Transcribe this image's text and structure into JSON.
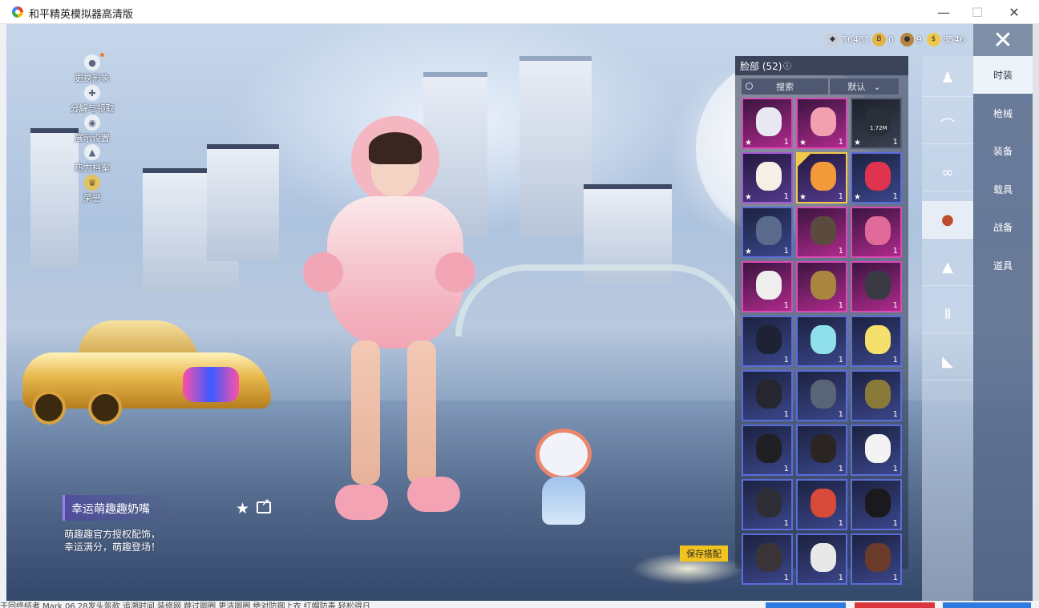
{
  "window": {
    "title": "和平精英模拟器高清版"
  },
  "desktop": {
    "bottom_text": "于回终结者 Mark 06 28发头盔款 追溯时间 装修网 跳过圆圈 更洁圆圈 绝对防御上衣 红帽防毒 轻松得日"
  },
  "left_menu": [
    {
      "label": "更换形象",
      "icon": "avatar-icon",
      "has_dot": true
    },
    {
      "label": "分解与领取",
      "icon": "puzzle-icon"
    },
    {
      "label": "展示设置",
      "icon": "eye-icon"
    },
    {
      "label": "热力档案",
      "icon": "flame-icon"
    },
    {
      "label": "荣誉",
      "icon": "crown-badge-icon"
    }
  ],
  "currency": [
    {
      "icon": "silver-coin-icon",
      "value": "56431",
      "color": "#c8cdd8"
    },
    {
      "icon": "gold-b-coin-icon",
      "value": "0",
      "color": "#e5b341"
    },
    {
      "icon": "bronze-coin-icon",
      "value": "9",
      "color": "#b8833b"
    },
    {
      "icon": "gold-coin-icon",
      "value": "8546",
      "color": "#f0c94b"
    }
  ],
  "panel": {
    "title": "脸部 (52)",
    "search_label": "搜索",
    "sort_label": "默认",
    "items": [
      {
        "name": "clown-mask",
        "rarity": "r-pink",
        "color": "#e8e8f2",
        "count": "1",
        "star": true
      },
      {
        "name": "pig-mask",
        "rarity": "r-pink",
        "color": "#f2a0b0",
        "count": "1",
        "star": true
      },
      {
        "name": "download-item",
        "rarity": "r-grey",
        "color": "#2a2f3a",
        "count": "1",
        "star": true,
        "download": "1.72M"
      },
      {
        "name": "egg-mask",
        "rarity": "r-purple",
        "color": "#f6efe6",
        "count": "1",
        "star": true
      },
      {
        "name": "pacifier",
        "rarity": "r-purple",
        "color": "#f29a3a",
        "count": "1",
        "star": true,
        "selected": true
      },
      {
        "name": "red-ball",
        "rarity": "r-blue",
        "color": "#e0344e",
        "count": "1",
        "star": true
      },
      {
        "name": "bandana",
        "rarity": "r-blue",
        "color": "#5a6a8c",
        "count": "1",
        "star": true
      },
      {
        "name": "gas-mask",
        "rarity": "r-pink",
        "color": "#5b4a3e",
        "count": "1"
      },
      {
        "name": "pink-hook",
        "rarity": "r-pink",
        "color": "#e06a9a",
        "count": "1"
      },
      {
        "name": "white-mask",
        "rarity": "r-pink",
        "color": "#eeeeee",
        "count": "1"
      },
      {
        "name": "gold-mask",
        "rarity": "r-pink",
        "color": "#a88640",
        "count": "1"
      },
      {
        "name": "demon-mask",
        "rarity": "r-pink",
        "color": "#3a3a44",
        "count": "1"
      },
      {
        "name": "dark-drip",
        "rarity": "r-blue",
        "color": "#1d2235",
        "count": "1"
      },
      {
        "name": "cyan-clown",
        "rarity": "r-blue",
        "color": "#8fe0ec",
        "count": "1"
      },
      {
        "name": "joker-mask",
        "rarity": "r-blue",
        "color": "#f4e06a",
        "count": "1"
      },
      {
        "name": "black-half-mask",
        "rarity": "r-blue",
        "color": "#26272e",
        "count": "1"
      },
      {
        "name": "dragon-mask",
        "rarity": "r-blue",
        "color": "#5a6478",
        "count": "1"
      },
      {
        "name": "gold-claw",
        "rarity": "r-blue",
        "color": "#8a7a3a",
        "count": "1"
      },
      {
        "name": "black-mask",
        "rarity": "r-blue",
        "color": "#1f1f24",
        "count": "1"
      },
      {
        "name": "black-mask-2",
        "rarity": "r-blue",
        "color": "#2a2522",
        "count": "1"
      },
      {
        "name": "white-beard",
        "rarity": "r-blue",
        "color": "#f3f3f3",
        "count": "1"
      },
      {
        "name": "cloth-mask",
        "rarity": "r-blue",
        "color": "#2e2f36",
        "count": "1"
      },
      {
        "name": "snorkel",
        "rarity": "r-blue",
        "color": "#d84a3a",
        "count": "1"
      },
      {
        "name": "logo-mask",
        "rarity": "r-blue",
        "color": "#1a1a1e",
        "count": "1"
      },
      {
        "name": "ninja-mask",
        "rarity": "r-blue",
        "color": "#3a3438",
        "count": "1"
      },
      {
        "name": "tribal-mask",
        "rarity": "r-blue",
        "color": "#e8e8e8",
        "count": "1"
      },
      {
        "name": "respirator",
        "rarity": "r-blue",
        "color": "#6a3a2a",
        "count": "1"
      }
    ]
  },
  "category_rail": [
    {
      "icon": "outfit-icon"
    },
    {
      "icon": "hat-icon"
    },
    {
      "icon": "glasses-icon"
    },
    {
      "icon": "face-icon",
      "active": true
    },
    {
      "icon": "top-icon"
    },
    {
      "icon": "pants-icon"
    },
    {
      "icon": "shoes-icon"
    }
  ],
  "tabs": [
    {
      "label": "时装",
      "active": true
    },
    {
      "label": "枪械"
    },
    {
      "label": "装备"
    },
    {
      "label": "载具"
    },
    {
      "label": "战备"
    },
    {
      "label": "道具"
    }
  ],
  "featured": {
    "name": "幸运萌趣趣奶嘴",
    "desc_line1": "萌趣趣官方授权配饰，",
    "desc_line2": "幸运满分，萌趣登场！"
  },
  "save_button": "保存搭配"
}
